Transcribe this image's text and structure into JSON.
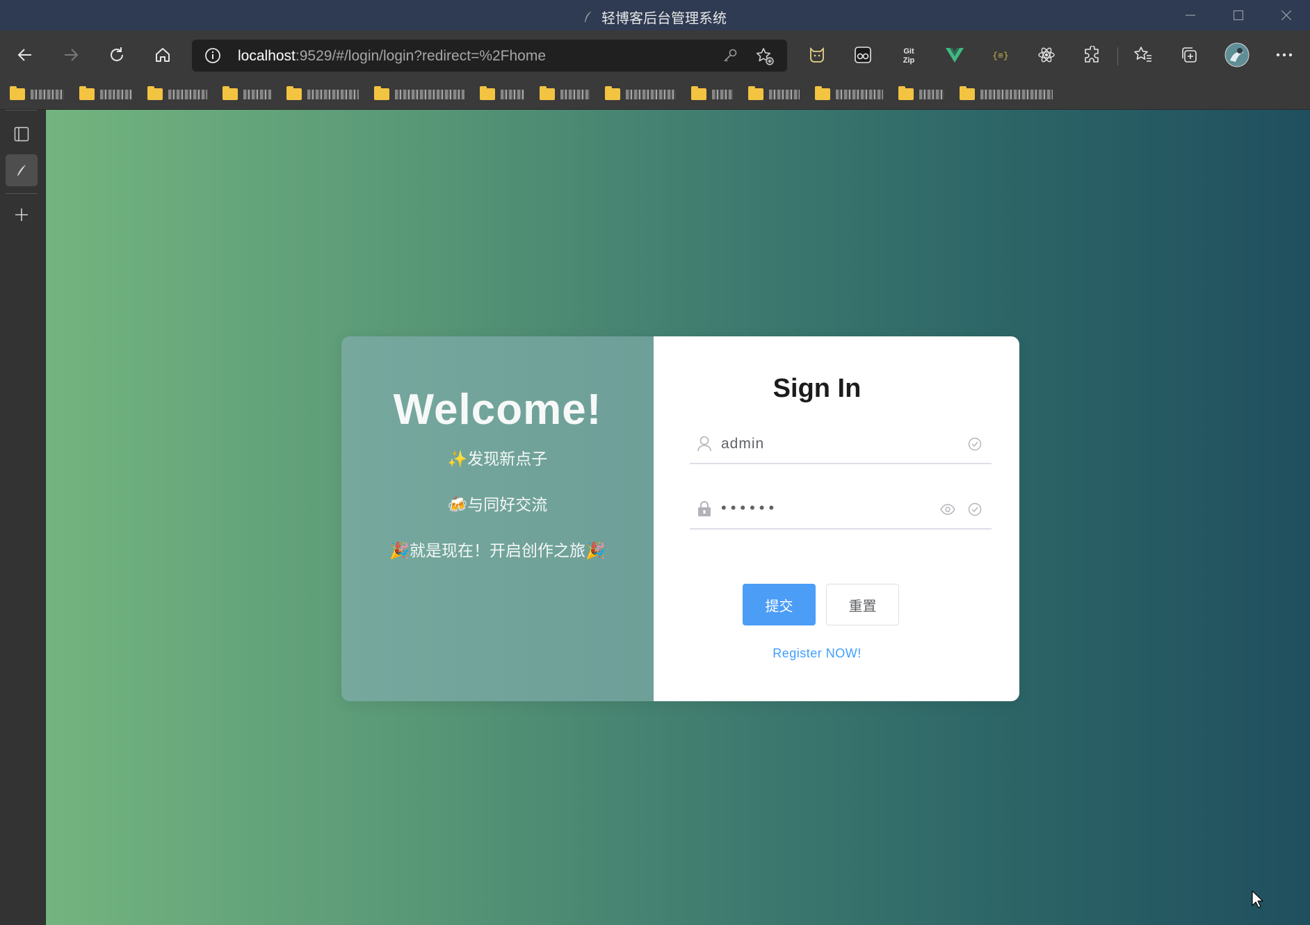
{
  "window": {
    "title": "轻博客后台管理系统"
  },
  "toolbar": {
    "url_host": "localhost",
    "url_rest": ":9529/#/login/login?redirect=%2Fhome"
  },
  "bookmarks": {
    "count": 14
  },
  "login": {
    "welcome": "Welcome!",
    "slogans": [
      "✨发现新点子",
      "🍻与同好交流",
      "🎉就是现在！开启创作之旅🎉"
    ],
    "heading": "Sign In",
    "username_value": "admin",
    "password_value": "••••••",
    "submit_label": "提交",
    "reset_label": "重置",
    "register_link": "Register NOW!"
  },
  "colors": {
    "primary": "#4c9df6",
    "link": "#409eff",
    "titlebar": "#2f3b52"
  },
  "icons": [
    "feather-icon",
    "back-icon",
    "forward-icon",
    "refresh-icon",
    "home-icon",
    "info-icon",
    "key-icon",
    "add-favorite-icon",
    "cat-extension-icon",
    "ghost-extension-icon",
    "gitzip-extension-icon",
    "vue-devtools-icon",
    "json-extension-icon",
    "react-devtools-icon",
    "extensions-icon",
    "favorites-icon",
    "collections-icon",
    "profile-avatar",
    "more-icon",
    "tab-actions-icon",
    "pen-icon",
    "plus-icon",
    "user-icon",
    "lock-icon",
    "eye-icon",
    "check-circle-icon"
  ]
}
